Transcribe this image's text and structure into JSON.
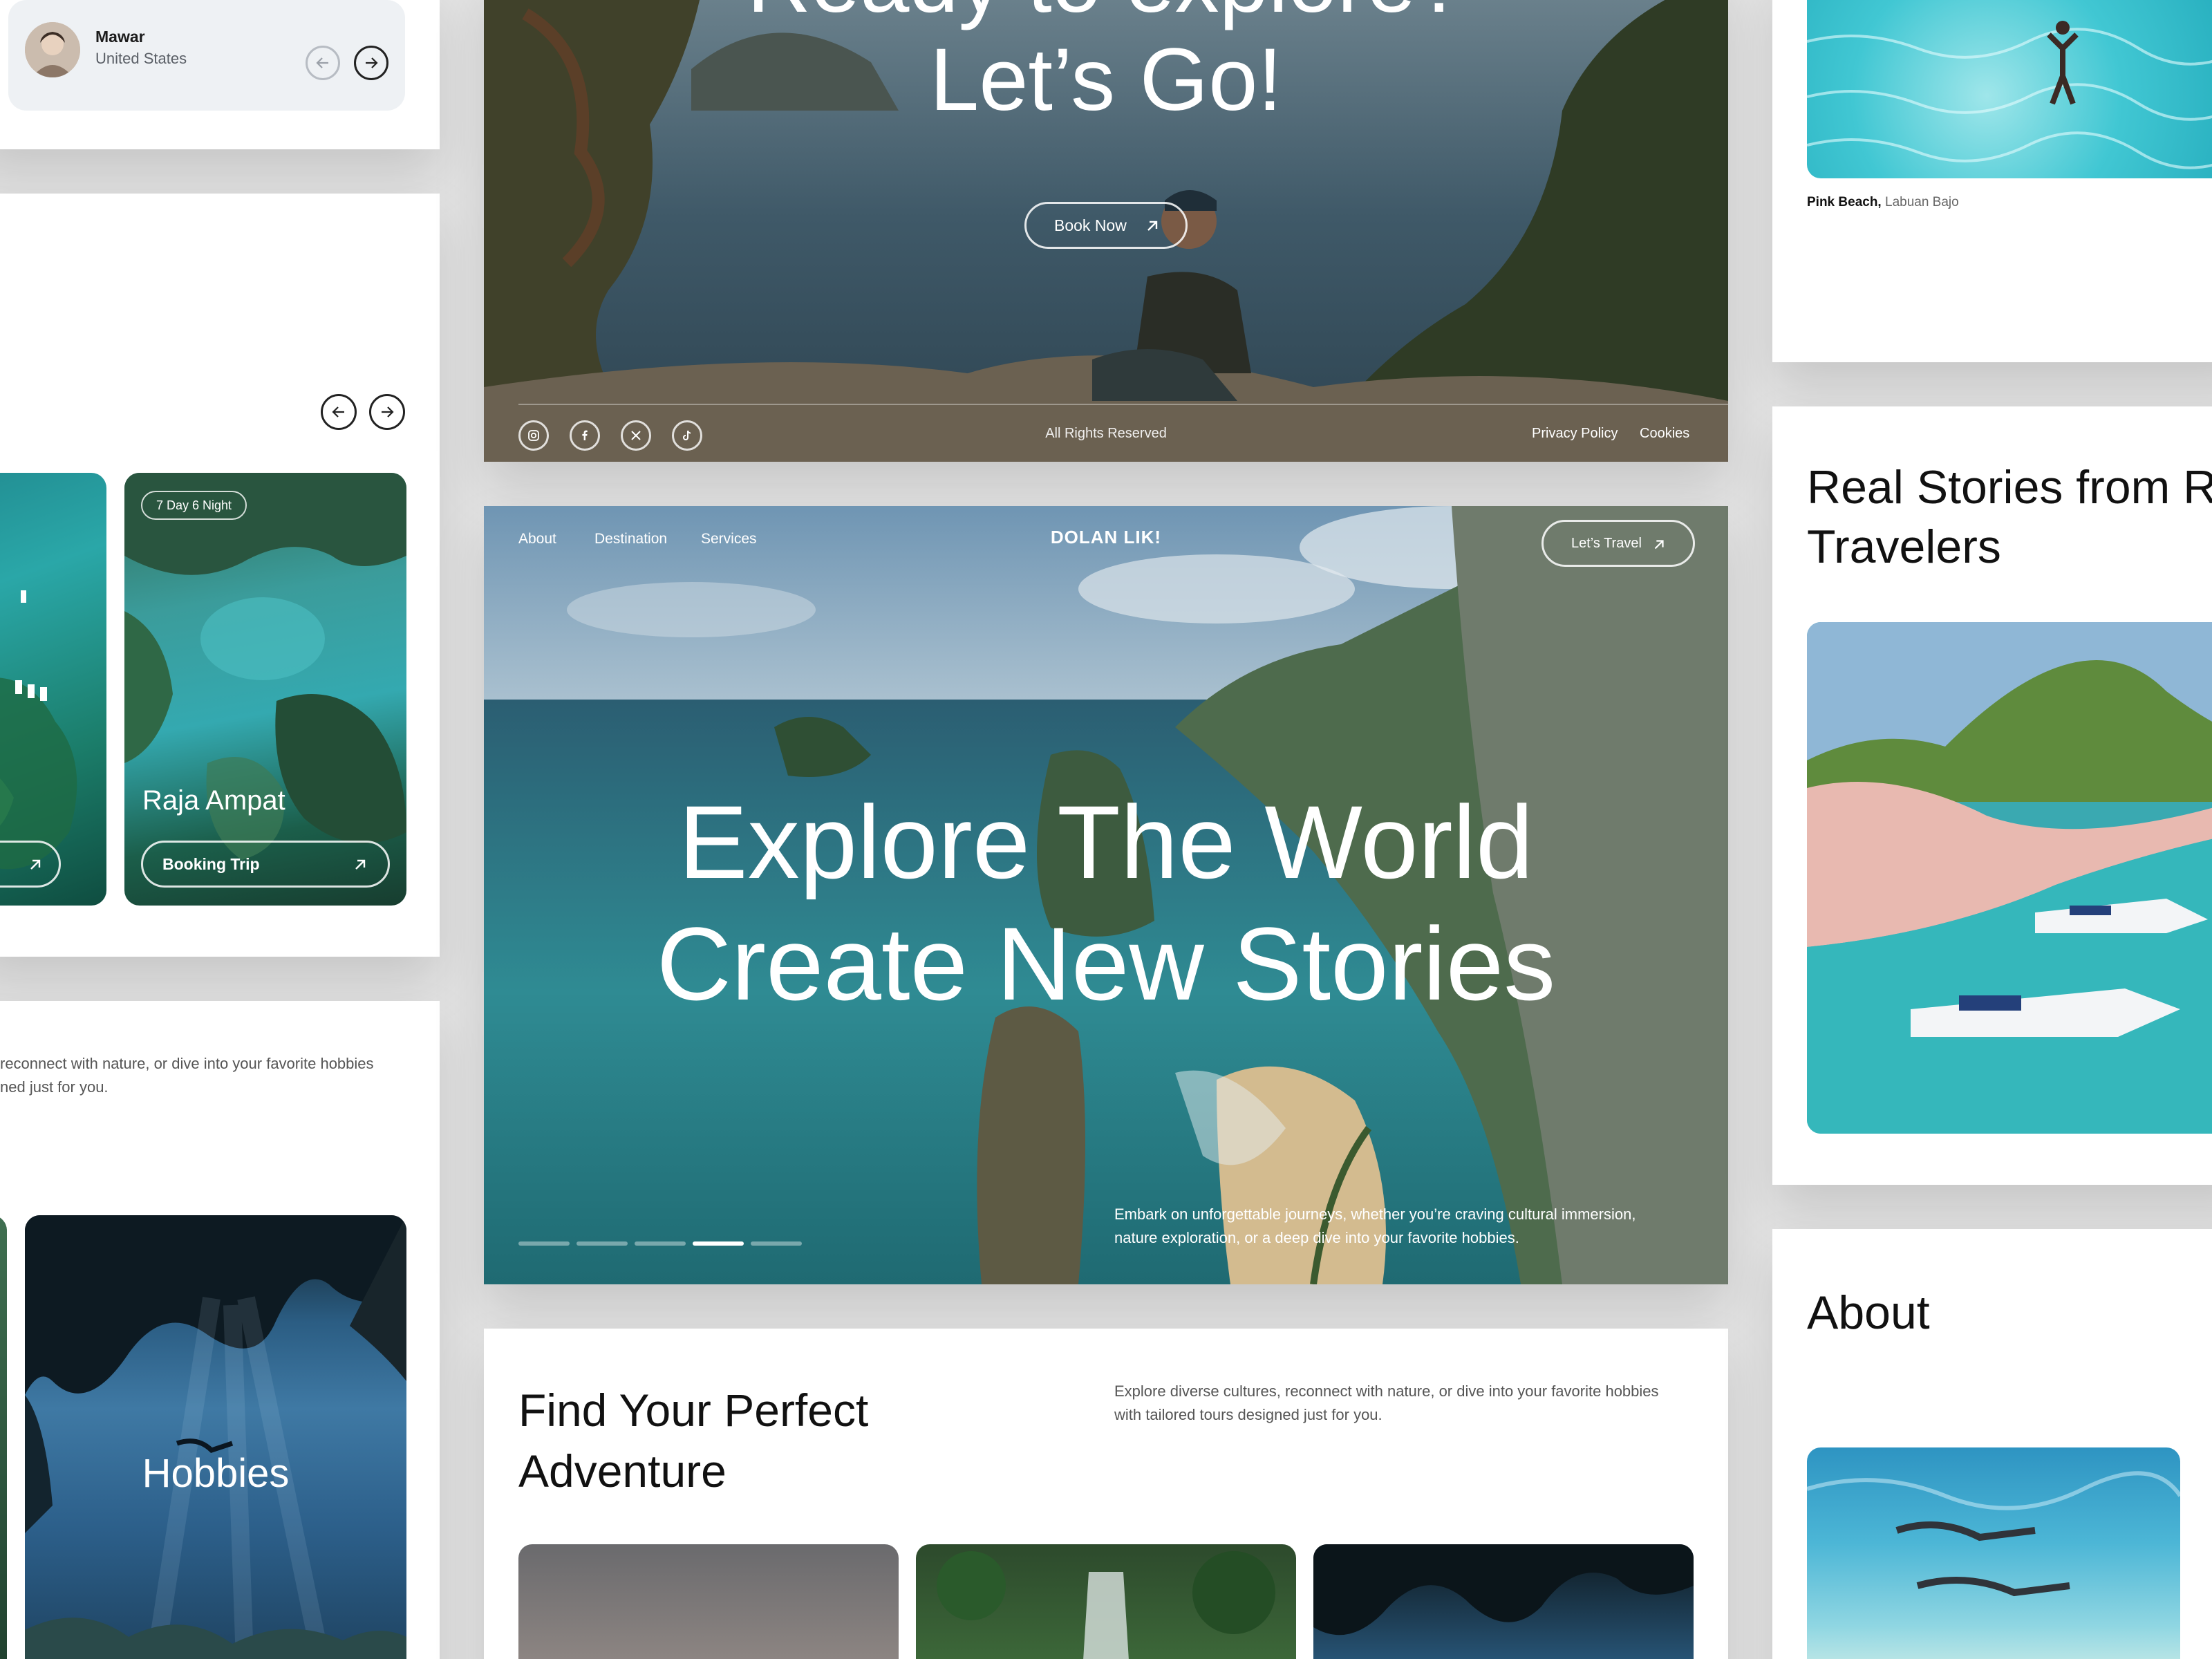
{
  "reviewer": {
    "name": "Mawar",
    "country": "United States",
    "prev_icon": "arrow-left-icon",
    "next_icon": "arrow-right-icon"
  },
  "destinations": {
    "prev_icon": "arrow-left-icon",
    "next_icon": "arrow-right-icon",
    "cards": [
      {
        "badge": "7 Day 6 Night",
        "title": "Raja Ampat",
        "button": "Booking Trip",
        "arrow_icon": "arrow-up-right-icon"
      }
    ]
  },
  "left_intro": {
    "text_line1": "reconnect with nature, or dive into your favorite hobbies",
    "text_line2": "ned just for you."
  },
  "hobbies_card": {
    "title": "Hobbies"
  },
  "cta": {
    "title_line1": "Ready to explore?",
    "title_line2": "Let’s Go!",
    "button": "Book Now",
    "social_icons": [
      "instagram-icon",
      "facebook-icon",
      "x-twitter-icon",
      "tiktok-icon"
    ],
    "copyright": "All Rights Reserved",
    "links": [
      "Privacy Policy",
      "Cookies"
    ]
  },
  "hero": {
    "nav": [
      "About",
      "Destination",
      "Services"
    ],
    "logo": "DOLAN LIK!",
    "cta_button": "Let’s Travel",
    "title_line1": "Explore The World",
    "title_line2": "Create New Stories",
    "desc_line1": "Embark on unforgettable journeys, whether you’re craving cultural immersion,",
    "desc_line2": "nature exploration, or a deep dive into your favorite hobbies.",
    "slides_total": 5,
    "active_slide": 4
  },
  "adventure": {
    "title_line1": "Find Your Perfect",
    "title_line2": "Adventure",
    "desc_line1": "Explore diverse cultures, reconnect with nature, or dive into your favorite hobbies",
    "desc_line2": "with tailored tours designed just for you."
  },
  "gallery": {
    "place": "Pink Beach,",
    "region": " Labuan Bajo"
  },
  "stories": {
    "title_line1": "Real Stories from R",
    "title_line2": "Travelers"
  },
  "about": {
    "title": "About"
  },
  "colors": {
    "dark_text": "#111111",
    "sea_teal": "#2f9aa0",
    "sky_blue": "#7fa6c4",
    "panel_bg": "#ffffff",
    "page_bg": "#e4e4e4"
  }
}
